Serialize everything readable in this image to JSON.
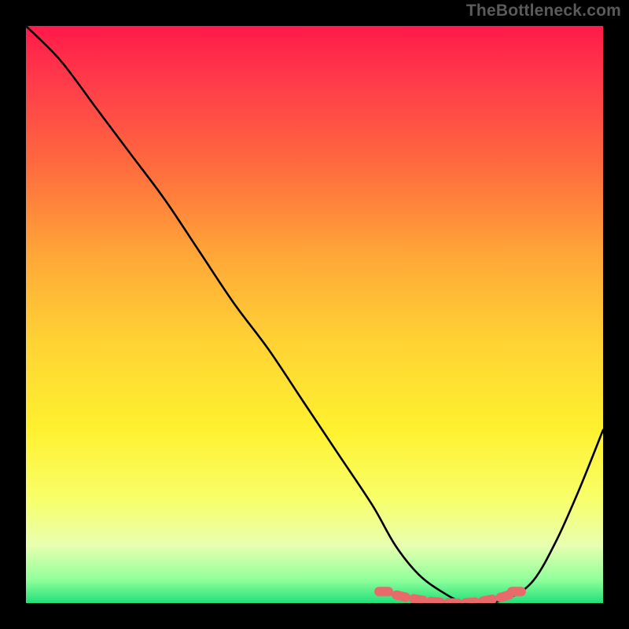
{
  "watermark": "TheBottleneck.com",
  "chart_data": {
    "type": "line",
    "title": "",
    "xlabel": "",
    "ylabel": "",
    "xlim": [
      0,
      100
    ],
    "ylim": [
      0,
      100
    ],
    "series": [
      {
        "name": "bottleneck-curve",
        "x": [
          0,
          6,
          12,
          18,
          24,
          30,
          36,
          42,
          48,
          54,
          60,
          64,
          68,
          72,
          76,
          80,
          84,
          88,
          92,
          96,
          100
        ],
        "y": [
          100,
          94,
          86,
          78,
          70,
          61,
          52,
          44,
          35,
          26,
          17,
          10,
          5,
          2,
          0,
          0,
          1,
          4,
          11,
          20,
          30
        ]
      }
    ],
    "markers": {
      "name": "highlight-band",
      "x": [
        62,
        65,
        68,
        71,
        74,
        77,
        80,
        83,
        85
      ],
      "y": [
        2,
        1.2,
        0.6,
        0.2,
        0,
        0.1,
        0.5,
        1.2,
        2
      ]
    },
    "gradient_stops": [
      {
        "pos": 0.0,
        "color": "#ff1a4a"
      },
      {
        "pos": 0.1,
        "color": "#ff3c4a"
      },
      {
        "pos": 0.24,
        "color": "#ff6a3e"
      },
      {
        "pos": 0.4,
        "color": "#ffa838"
      },
      {
        "pos": 0.55,
        "color": "#ffd334"
      },
      {
        "pos": 0.7,
        "color": "#fff12f"
      },
      {
        "pos": 0.82,
        "color": "#f8ff6a"
      },
      {
        "pos": 0.9,
        "color": "#e8ffb0"
      },
      {
        "pos": 0.96,
        "color": "#8fff9a"
      },
      {
        "pos": 1.0,
        "color": "#20e07a"
      }
    ]
  }
}
